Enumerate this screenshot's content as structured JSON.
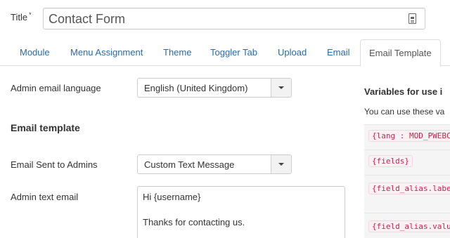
{
  "title_field": {
    "label": "Title",
    "required_mark": "*",
    "value": "Contact Form",
    "icon": "document-icon"
  },
  "tabs": [
    {
      "label": "Module",
      "active": false
    },
    {
      "label": "Menu Assignment",
      "active": false
    },
    {
      "label": "Theme",
      "active": false
    },
    {
      "label": "Toggler Tab",
      "active": false
    },
    {
      "label": "Upload",
      "active": false
    },
    {
      "label": "Email",
      "active": false
    },
    {
      "label": "Email Template",
      "active": true
    }
  ],
  "form": {
    "admin_email_language": {
      "label": "Admin email language",
      "value": "English (United Kingdom)"
    },
    "section_title": "Email template",
    "email_sent_to_admins": {
      "label": "Email Sent to Admins",
      "value": "Custom Text Message"
    },
    "admin_text_email": {
      "label": "Admin text email",
      "lines": [
        "Hi {username}",
        "",
        "Thanks for contacting us."
      ]
    }
  },
  "variables": {
    "title": "Variables for use i",
    "subtitle": "You can use these va",
    "items": [
      "{lang : MOD_PWEBC",
      "{fields}",
      "{field_alias.labe",
      "{field_alias.valu"
    ]
  },
  "colors": {
    "link": "#2a6aa8",
    "code_text": "#c7254e",
    "code_bg": "#f9f2f4"
  }
}
